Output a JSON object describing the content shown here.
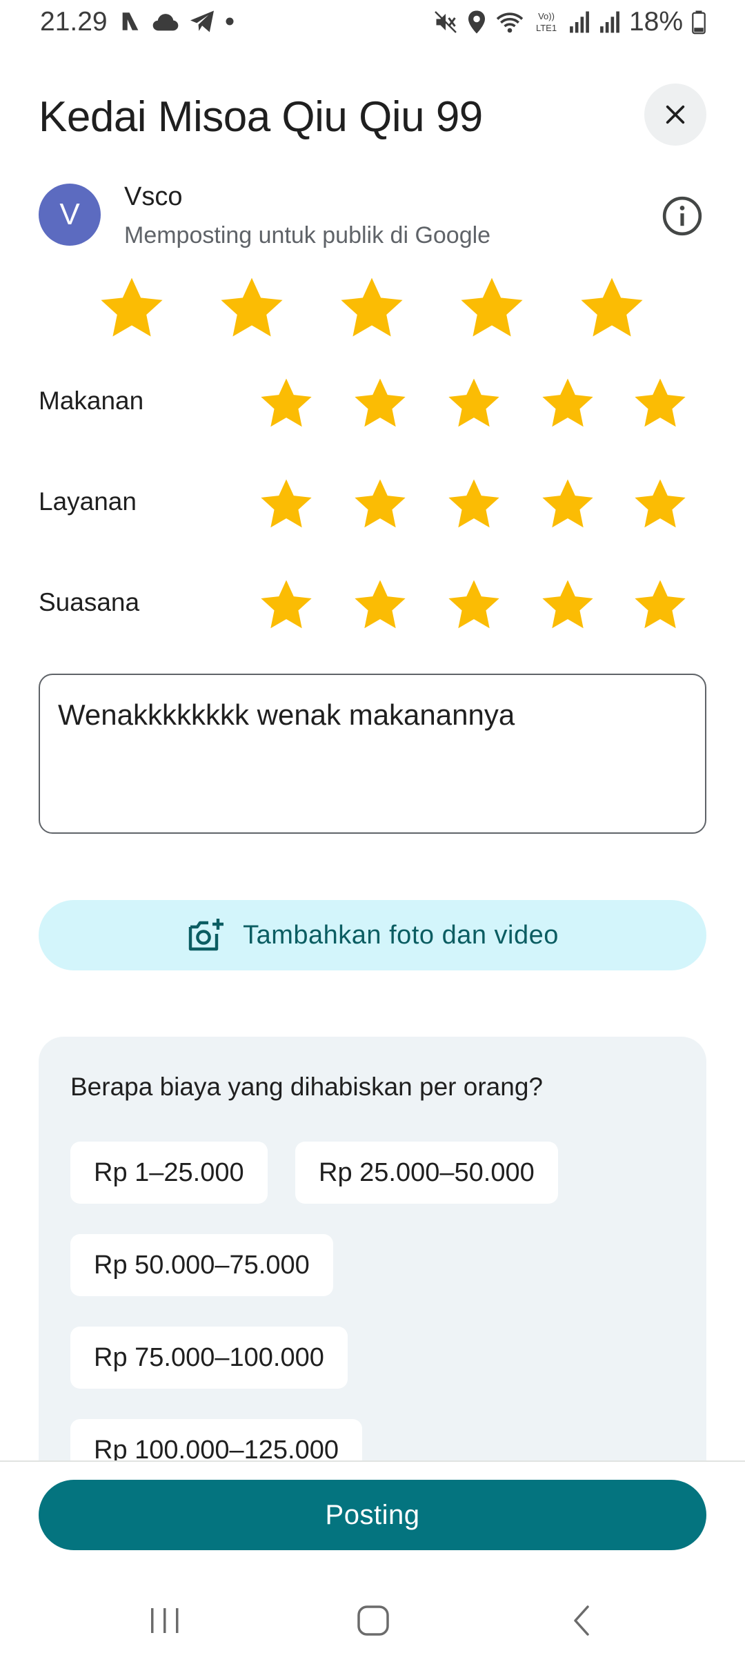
{
  "status_bar": {
    "time": "21.29",
    "left_icons": [
      "nfc-tap-icon",
      "cloud-icon",
      "telegram-icon",
      "dot-icon"
    ],
    "right_icons": [
      "mute-icon",
      "location-icon",
      "wifi-icon",
      "volte-icon",
      "signal-icon",
      "signal-icon"
    ],
    "volte_text": "Vo)) LTE1",
    "battery": "18%"
  },
  "header": {
    "title": "Kedai Misoa Qiu Qiu 99",
    "close_icon": "close-icon"
  },
  "user": {
    "avatar_letter": "V",
    "avatar_color": "#5c6bc0",
    "name": "Vsco",
    "subtitle": "Memposting untuk publik di Google",
    "info_icon": "info-icon"
  },
  "rating": {
    "overall": 5,
    "max": 5,
    "star_color": "#fbbc04"
  },
  "aspects": [
    {
      "label": "Makanan",
      "rating": 5
    },
    {
      "label": "Layanan",
      "rating": 5
    },
    {
      "label": "Suasana",
      "rating": 5
    }
  ],
  "review": {
    "value": "Wenakkkkkkkk wenak makanannya"
  },
  "add_photo": {
    "label": "Tambahkan foto dan video",
    "icon": "add-photo-icon"
  },
  "price": {
    "question": "Berapa biaya yang dihabiskan per orang?",
    "options": [
      "Rp 1–25.000",
      "Rp 25.000–50.000",
      "Rp 50.000–75.000",
      "Rp 75.000–100.000",
      "Rp 100.000–125.000"
    ]
  },
  "post_button": {
    "label": "Posting",
    "color": "#04747f"
  },
  "nav": [
    "recents-icon",
    "home-icon",
    "back-icon"
  ]
}
